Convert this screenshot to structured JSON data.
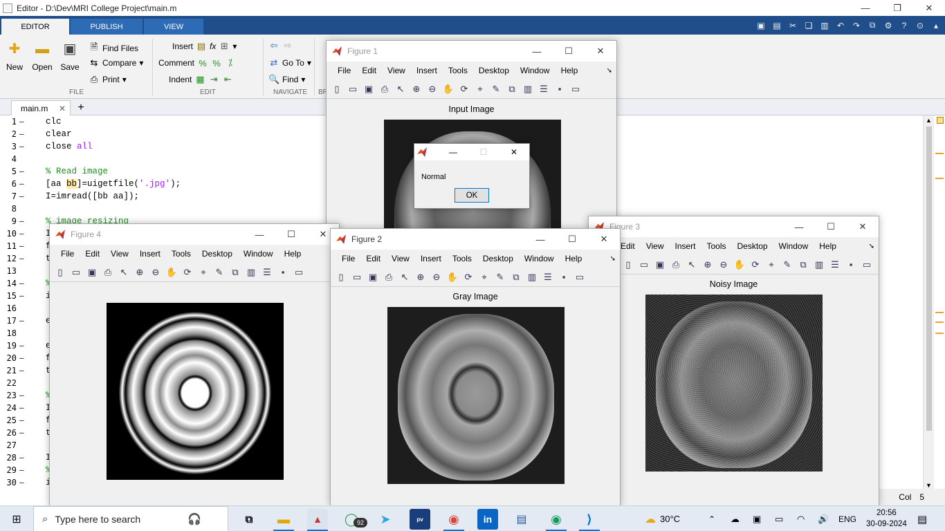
{
  "editor": {
    "title": "Editor - D:\\Dev\\MRI College Project\\main.m",
    "window_controls": {
      "minimize": "—",
      "restore": "❐",
      "close": "✕"
    }
  },
  "ribbon_tabs": [
    "EDITOR",
    "PUBLISH",
    "VIEW"
  ],
  "ribbon": {
    "file": {
      "new": "New",
      "open": "Open",
      "save": "Save",
      "find_files": "Find Files",
      "compare": "Compare",
      "print": "Print",
      "group": "FILE"
    },
    "edit": {
      "insert": "Insert",
      "comment": "Comment",
      "indent": "Indent",
      "fx": "fx",
      "group": "EDIT"
    },
    "navigate": {
      "go_to": "Go To",
      "find": "Find",
      "group": "NAVIGATE",
      "partial": "BR"
    }
  },
  "file_tabs": {
    "active": "main.m",
    "close": "✕",
    "add": "+"
  },
  "code_lines": [
    {
      "n": "1",
      "parts": [
        {
          "t": "clc",
          "c": ""
        }
      ]
    },
    {
      "n": "2",
      "parts": [
        {
          "t": "clear",
          "c": ""
        }
      ]
    },
    {
      "n": "3",
      "parts": [
        {
          "t": "close ",
          "c": ""
        },
        {
          "t": "all",
          "c": "str"
        }
      ]
    },
    {
      "n": "4",
      "parts": []
    },
    {
      "n": "5",
      "parts": [
        {
          "t": "% Read image",
          "c": "cmt"
        }
      ]
    },
    {
      "n": "6",
      "parts": [
        {
          "t": "[aa ",
          "c": ""
        },
        {
          "t": "bb",
          "c": "hl"
        },
        {
          "t": "]=uigetfile(",
          "c": ""
        },
        {
          "t": "'.jpg'",
          "c": "str"
        },
        {
          "t": ");",
          "c": ""
        }
      ]
    },
    {
      "n": "7",
      "parts": [
        {
          "t": "I=imread([bb aa]);",
          "c": ""
        }
      ]
    },
    {
      "n": "8",
      "parts": []
    },
    {
      "n": "9",
      "parts": [
        {
          "t": "% image resizing",
          "c": "cmt"
        }
      ]
    },
    {
      "n": "10",
      "parts": [
        {
          "t": "I",
          "c": ""
        }
      ]
    },
    {
      "n": "11",
      "parts": [
        {
          "t": "f",
          "c": ""
        }
      ]
    },
    {
      "n": "12",
      "parts": [
        {
          "t": "t",
          "c": ""
        }
      ]
    },
    {
      "n": "13",
      "parts": []
    },
    {
      "n": "14",
      "parts": [
        {
          "t": "%",
          "c": "cmt"
        }
      ]
    },
    {
      "n": "15",
      "parts": [
        {
          "t": "i",
          "c": ""
        }
      ]
    },
    {
      "n": "16",
      "parts": []
    },
    {
      "n": "17",
      "parts": [
        {
          "t": "e",
          "c": ""
        }
      ]
    },
    {
      "n": "18",
      "parts": []
    },
    {
      "n": "19",
      "parts": [
        {
          "t": "e",
          "c": ""
        }
      ]
    },
    {
      "n": "20",
      "parts": [
        {
          "t": "f",
          "c": ""
        }
      ]
    },
    {
      "n": "21",
      "parts": [
        {
          "t": "t",
          "c": ""
        }
      ]
    },
    {
      "n": "22",
      "parts": []
    },
    {
      "n": "23",
      "parts": [
        {
          "t": "%",
          "c": "cmt"
        }
      ]
    },
    {
      "n": "24",
      "parts": [
        {
          "t": "I",
          "c": ""
        }
      ]
    },
    {
      "n": "25",
      "parts": [
        {
          "t": "f",
          "c": ""
        }
      ]
    },
    {
      "n": "26",
      "parts": [
        {
          "t": "t",
          "c": ""
        }
      ]
    },
    {
      "n": "27",
      "parts": []
    },
    {
      "n": "28",
      "parts": [
        {
          "t": "I",
          "c": ""
        }
      ]
    },
    {
      "n": "29",
      "parts": [
        {
          "t": "%",
          "c": "cmt"
        }
      ]
    },
    {
      "n": "30",
      "parts": [
        {
          "t": "i",
          "c": ""
        }
      ]
    }
  ],
  "status": {
    "col_label": "Col",
    "col_value": "5"
  },
  "figure_menu": [
    "File",
    "Edit",
    "View",
    "Insert",
    "Tools",
    "Desktop",
    "Window",
    "Help"
  ],
  "figure_menu_fig3": [
    "Edit",
    "View",
    "Insert",
    "Tools",
    "Desktop",
    "Window",
    "Help"
  ],
  "figures": {
    "fig1": {
      "title": "Figure 1",
      "axis_title": "Input Image"
    },
    "fig2": {
      "title": "Figure 2",
      "axis_title": "Gray Image"
    },
    "fig3": {
      "title": "Figure 3",
      "axis_title": "Noisy Image"
    },
    "fig4": {
      "title": "Figure 4",
      "axis_title": ""
    }
  },
  "dialog": {
    "message": "Normal",
    "ok": "OK"
  },
  "taskbar": {
    "search_placeholder": "Type here to search",
    "whatsapp_badge": "92",
    "weather": "30°C",
    "language": "ENG",
    "time": "20:56",
    "date": "30-09-2024"
  },
  "colors": {
    "ribbon_blue": "#1f4e8a",
    "comment": "#228b22",
    "string": "#a020f0",
    "taskbar": "#e3eaf3"
  }
}
